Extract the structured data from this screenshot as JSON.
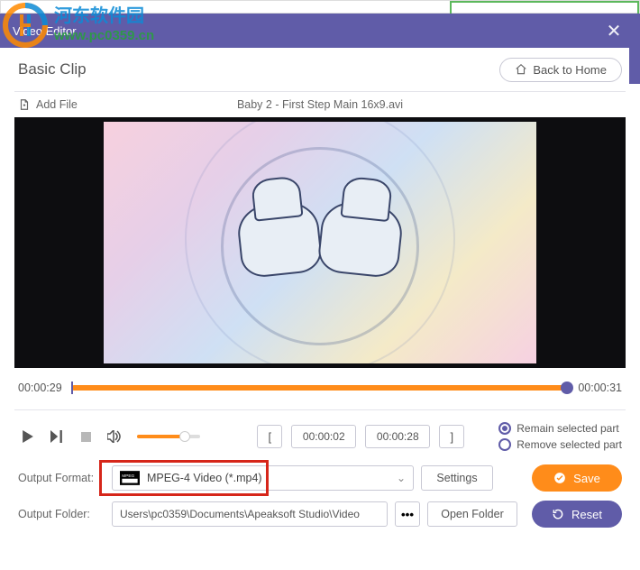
{
  "watermark": {
    "site": "河东软件园",
    "url": "www.pc0359.cn"
  },
  "title_bar": {
    "title": "Video Editor",
    "close": "✕"
  },
  "header": {
    "section": "Basic Clip",
    "back_label": "Back to Home"
  },
  "file": {
    "add_label": "Add File",
    "name": "Baby 2 - First Step Main 16x9.avi"
  },
  "timeline": {
    "current": "00:00:29",
    "total": "00:00:31"
  },
  "clip": {
    "start": "00:00:02",
    "end": "00:00:28",
    "left_bracket": "[",
    "right_bracket": "]"
  },
  "radio": {
    "remain": "Remain selected part",
    "remove": "Remove selected part"
  },
  "output": {
    "format_label": "Output Format:",
    "format_value": "MPEG-4 Video (*.mp4)",
    "settings_btn": "Settings",
    "folder_label": "Output Folder:",
    "folder_value": "Users\\pc0359\\Documents\\Apeaksoft Studio\\Video",
    "open_folder_btn": "Open Folder",
    "more": "•••"
  },
  "actions": {
    "save": "Save",
    "reset": "Reset"
  }
}
